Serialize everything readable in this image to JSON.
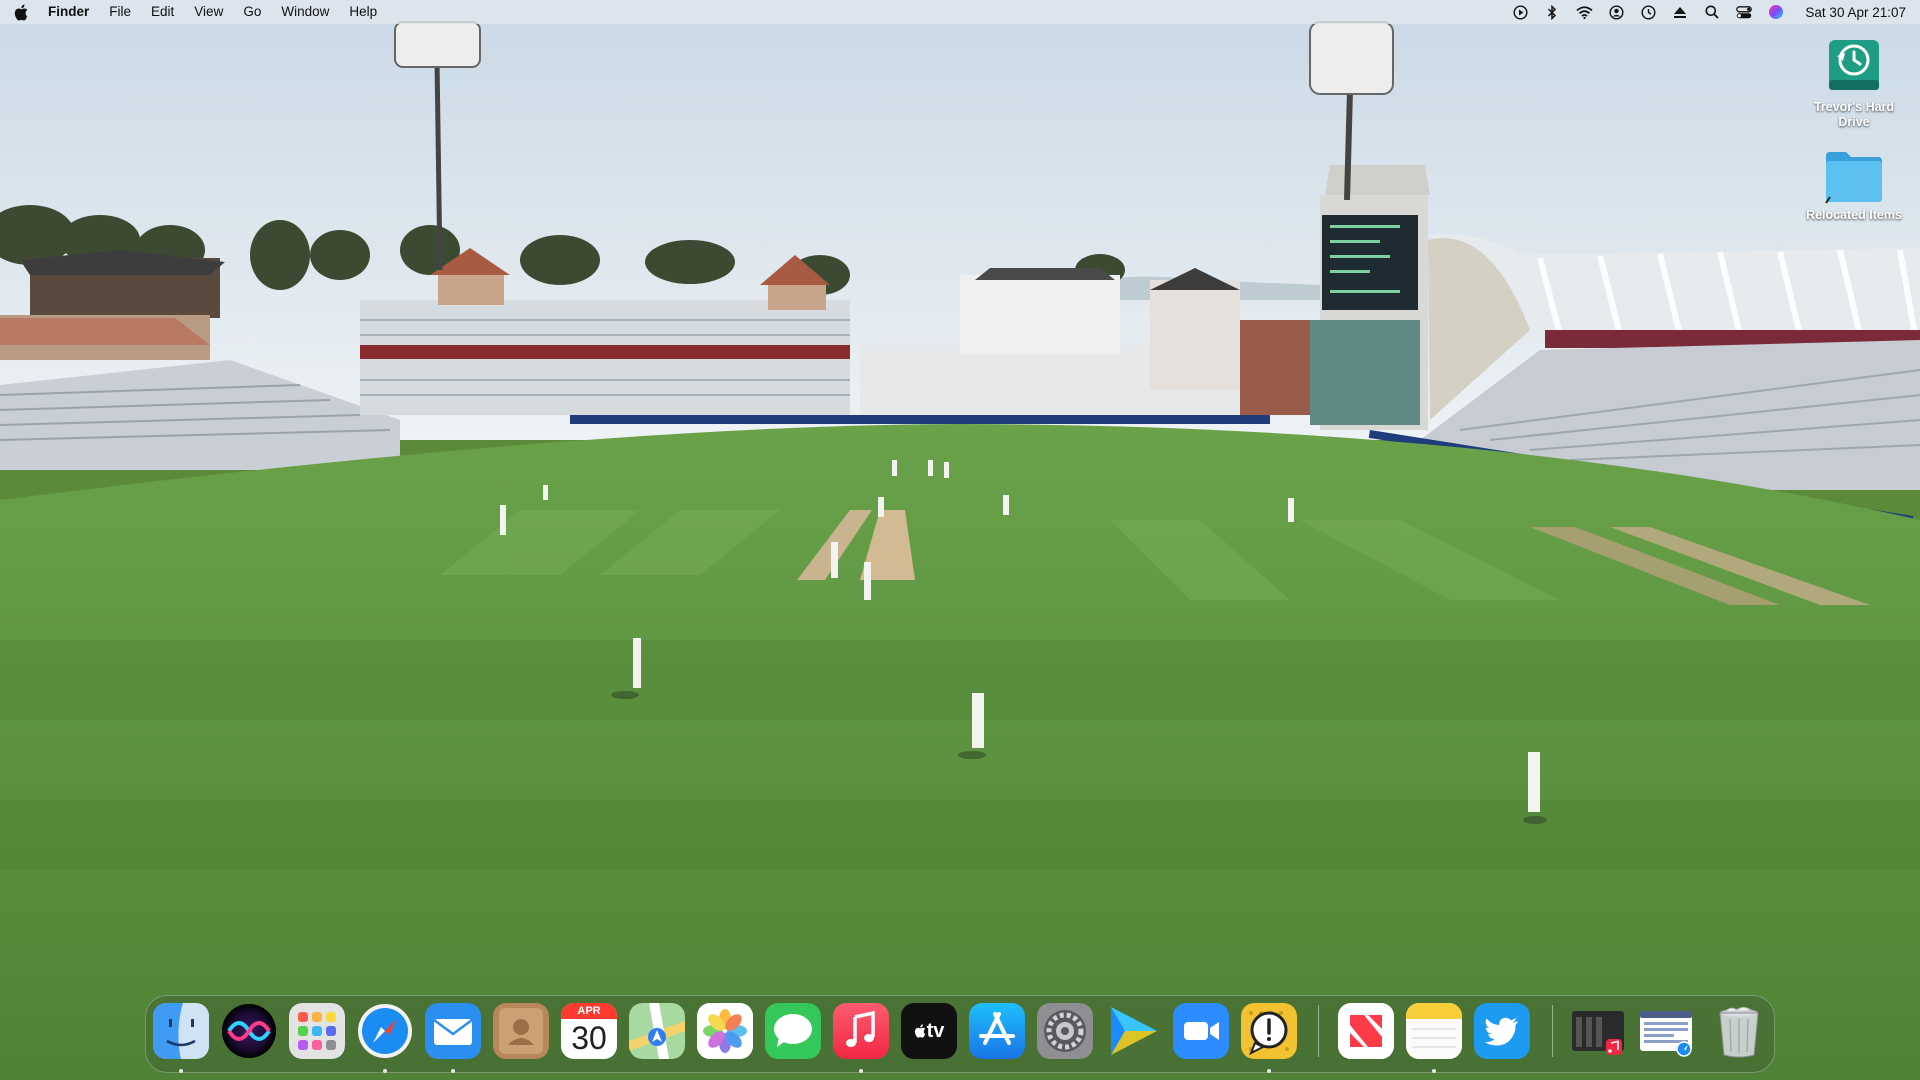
{
  "menubar": {
    "app_name": "Finder",
    "items": [
      "File",
      "Edit",
      "View",
      "Go",
      "Window",
      "Help"
    ],
    "status_icons": [
      "play-icon",
      "bluetooth-icon",
      "wifi-icon",
      "user-icon",
      "time-machine-icon",
      "eject-icon",
      "spotlight-search-icon",
      "control-center-icon",
      "siri-icon"
    ],
    "clock": "Sat 30 Apr  21:07"
  },
  "desktop": {
    "icons": [
      {
        "label": "Trevor's Hard Drive",
        "icon": "time-machine-drive-icon"
      },
      {
        "label": "Relocated Items",
        "icon": "folder-icon"
      }
    ]
  },
  "dock": {
    "apps": [
      {
        "name": "Finder",
        "icon": "finder-icon",
        "running": true
      },
      {
        "name": "Siri",
        "icon": "siri-icon",
        "running": false
      },
      {
        "name": "Launchpad",
        "icon": "launchpad-icon",
        "running": false
      },
      {
        "name": "Safari",
        "icon": "safari-icon",
        "running": true
      },
      {
        "name": "Mail",
        "icon": "mail-icon",
        "running": true
      },
      {
        "name": "Contacts",
        "icon": "contacts-icon",
        "running": false
      },
      {
        "name": "Calendar",
        "icon": "calendar-icon",
        "running": false,
        "month": "APR",
        "day": "30"
      },
      {
        "name": "Maps",
        "icon": "maps-icon",
        "running": false
      },
      {
        "name": "Photos",
        "icon": "photos-icon",
        "running": false
      },
      {
        "name": "Messages",
        "icon": "messages-icon",
        "running": false
      },
      {
        "name": "Music",
        "icon": "music-icon",
        "running": true
      },
      {
        "name": "TV",
        "icon": "apple-tv-icon",
        "running": false,
        "text": "tv"
      },
      {
        "name": "App Store",
        "icon": "app-store-icon",
        "running": false
      },
      {
        "name": "System Preferences",
        "icon": "system-preferences-icon",
        "running": false
      },
      {
        "name": "Infuse",
        "icon": "infuse-play-icon",
        "running": false
      },
      {
        "name": "Zoom",
        "icon": "zoom-icon",
        "running": false
      },
      {
        "name": "Console",
        "icon": "console-icon",
        "running": true
      },
      {
        "name": "News",
        "icon": "news-icon",
        "running": false
      },
      {
        "name": "Notes",
        "icon": "notes-icon",
        "running": true
      },
      {
        "name": "Twitter",
        "icon": "twitter-icon",
        "running": false
      }
    ],
    "recent": [
      {
        "name": "Music minimized window",
        "icon": "minimized-window-music-icon"
      },
      {
        "name": "Safari minimized window",
        "icon": "minimized-window-safari-icon"
      }
    ],
    "trash": {
      "name": "Trash",
      "icon": "trash-icon"
    }
  },
  "colors": {
    "menubar_bg": "#e1e8ee",
    "sky": "#dbe6ef",
    "grass": "#5e9440",
    "folder_blue": "#45b1e8"
  }
}
